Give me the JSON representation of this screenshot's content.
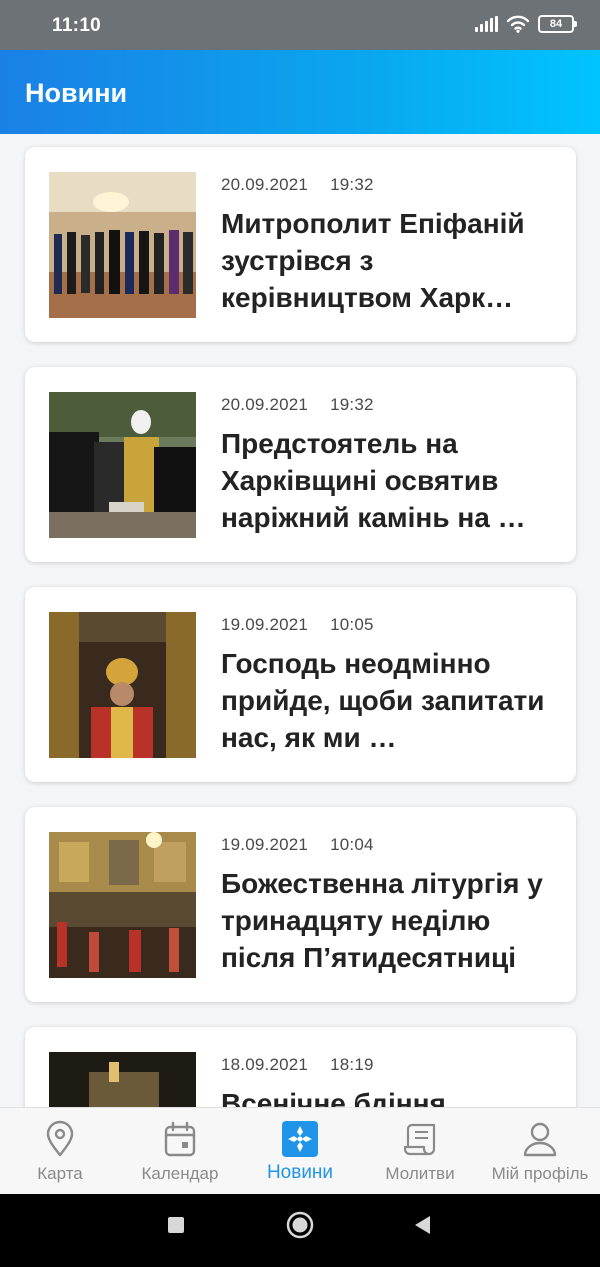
{
  "status_bar": {
    "time": "11:10",
    "battery": "84"
  },
  "header": {
    "title": "Новини"
  },
  "news": [
    {
      "date": "20.09.2021",
      "time": "19:32",
      "title": "Митрополит Епіфаній зустрівся з керівництвом Харк…"
    },
    {
      "date": "20.09.2021",
      "time": "19:32",
      "title": "Предстоятель на Харківщині освятив наріжний камінь на …"
    },
    {
      "date": "19.09.2021",
      "time": "10:05",
      "title": "Господь неодмінно прийде, щоби запитати нас, як ми …"
    },
    {
      "date": "19.09.2021",
      "time": "10:04",
      "title": "Божественна літургія у тринадцяту неділю після П’ятидесятниці"
    },
    {
      "date": "18.09.2021",
      "time": "18:19",
      "title": "Всенічне бдіння"
    }
  ],
  "bottom_nav": {
    "items": [
      {
        "label": "Карта",
        "icon": "map-pin-icon"
      },
      {
        "label": "Календар",
        "icon": "calendar-icon"
      },
      {
        "label": "Новини",
        "icon": "news-cross-icon",
        "active": true
      },
      {
        "label": "Молитви",
        "icon": "scroll-icon"
      },
      {
        "label": "Мій профіль",
        "icon": "profile-icon"
      }
    ]
  },
  "colors": {
    "header_start": "#1a80e6",
    "header_end": "#00c4ff",
    "active_tab": "#1f94e8",
    "inactive_tab": "#8a8a8a"
  }
}
